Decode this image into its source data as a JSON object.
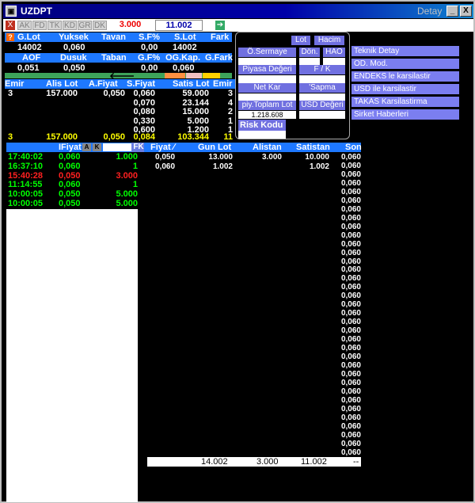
{
  "window": {
    "title": "UZDPT",
    "detay": "Detay",
    "btn_min": "_",
    "btn_max": "□",
    "btn_close": "X"
  },
  "toolbar": {
    "tabs": [
      "AK",
      "FD",
      "TK",
      "KD",
      "GR",
      "DK"
    ],
    "value_red": "3.000",
    "value_blue": "11.002",
    "arrow": "➔",
    "close": "X"
  },
  "summary": {
    "headers1": [
      "G.Lot",
      "Yuksek",
      "Tavan",
      "S.F%",
      "S.Lot",
      "Fark"
    ],
    "values1": [
      "14002",
      "0,060",
      "",
      "0,00",
      "14002",
      ""
    ],
    "headers2": [
      "AOF",
      "Dusuk",
      "Taban",
      "G.F%",
      "OG.Kap.",
      "G.Fark"
    ],
    "values2": [
      "0,051",
      "0,050",
      "",
      "0,00",
      "0,060",
      ""
    ]
  },
  "depth": {
    "headers": [
      "Emir",
      "Alis Lot",
      "A.Fiyat",
      "S.Fiyat",
      "Satis Lot",
      "Emir"
    ],
    "rows": [
      [
        "3",
        "157.000",
        "0,050",
        "0,060",
        "59.000",
        "3"
      ],
      [
        "",
        "",
        "",
        "0,070",
        "23.144",
        "4"
      ],
      [
        "",
        "",
        "",
        "0,080",
        "15.000",
        "2"
      ],
      [
        "",
        "",
        "",
        "0,330",
        "5.000",
        "1"
      ],
      [
        "",
        "",
        "",
        "0,600",
        "1.200",
        "1"
      ]
    ],
    "total": [
      "3",
      "157.000",
      "0,050",
      "0,084",
      "103.344",
      "11"
    ]
  },
  "panel": {
    "lot": "Lot",
    "hacim": "Hacim",
    "oser": "Ö.Sermaye",
    "don": "Dön.",
    "hao": "HAO",
    "piyasa": "Piyasa Değeri",
    "fk": "F / K",
    "netkar": "Net Kar",
    "sapma": "'Sapma",
    "piytoplam": "piy.Toplam Lot",
    "usd": "USD Değeri",
    "piy_value": "1.218.608",
    "risk": "Risk Kodu"
  },
  "links": [
    "Teknik Detay",
    "OD. Mod.",
    "ENDEKS le karsilastir",
    "USD ile karsilastir",
    "TAKAS Karsilastirma",
    "Sirket Haberleri"
  ],
  "trades": {
    "header": "IFiyat",
    "a": "A",
    "k": "K",
    "fk": "FK",
    "rows": [
      {
        "time": "17:40:02",
        "price": "0,060",
        "lot": "1.000",
        "color": "#00ff00"
      },
      {
        "time": "16:37:10",
        "price": "0,060",
        "lot": "1",
        "color": "#00ff00"
      },
      {
        "time": "15:40:28",
        "price": "0,050",
        "lot": "3.000",
        "color": "#ff2020"
      },
      {
        "time": "11:14:55",
        "price": "0,060",
        "lot": "1",
        "color": "#00ff00"
      },
      {
        "time": "10:00:05",
        "price": "0,050",
        "lot": "5.000",
        "color": "#00ff00"
      },
      {
        "time": "10:00:05",
        "price": "0,050",
        "lot": "5.000",
        "color": "#00ff00"
      }
    ]
  },
  "pricebook": {
    "headers": [
      "Fiyat ∕",
      "Gun Lot",
      "Alistan",
      "Satistan",
      "Son"
    ],
    "rows": [
      [
        "0,050",
        "13.000",
        "3.000",
        "10.000"
      ],
      [
        "0,060",
        "1.002",
        "",
        "1.002"
      ]
    ],
    "son": "0,060",
    "son_count": 35,
    "totals": [
      "14.002",
      "3.000",
      "11.002",
      "--"
    ]
  }
}
